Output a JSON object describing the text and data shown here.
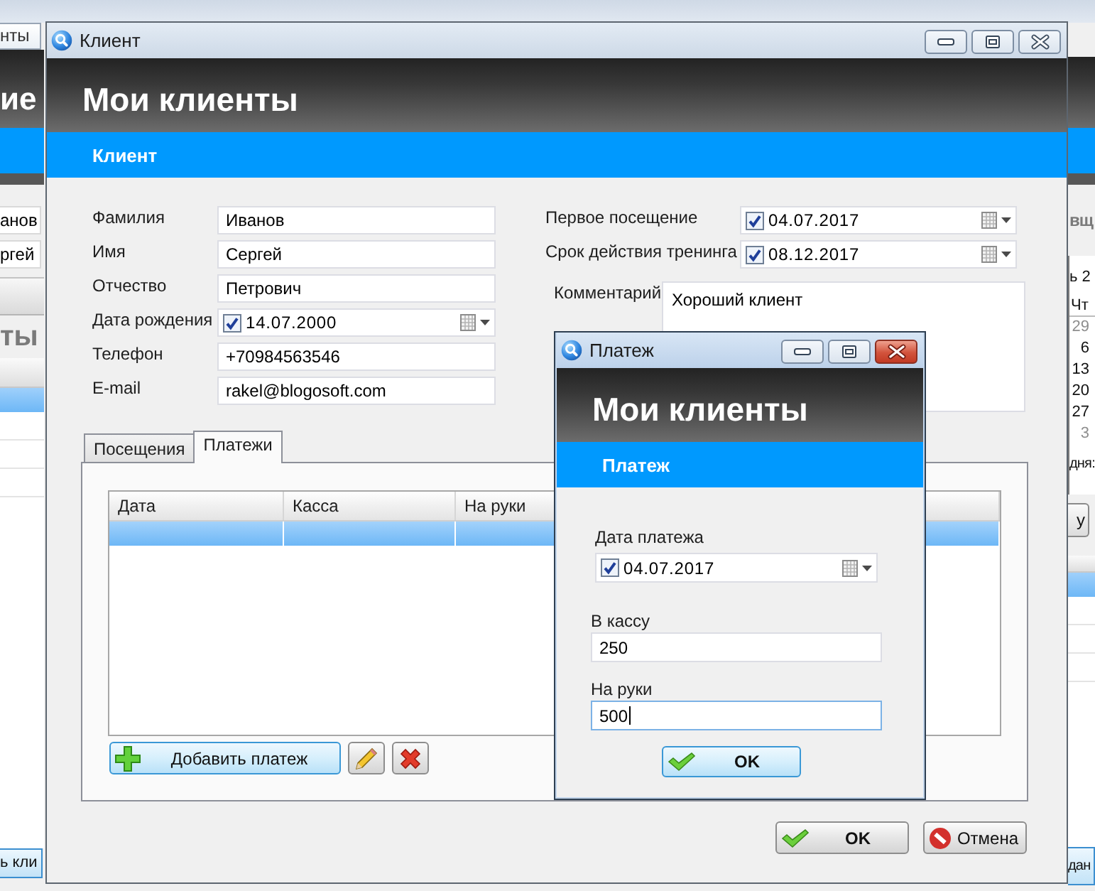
{
  "background_app": {
    "left": {
      "tab": "нты",
      "app_title": "ие",
      "fields": [
        "анов",
        "ргей"
      ],
      "section_heading": "ты",
      "table_rows": [
        {
          "selected": true
        },
        {
          "selected": false
        },
        {
          "selected": false
        },
        {
          "selected": false
        }
      ],
      "button": "ь кли"
    },
    "right": {
      "section_heading": "вщ",
      "calendar": {
        "month": "ь 2",
        "weekday": "Чт",
        "days": [
          {
            "label": "29",
            "other_month": true
          },
          {
            "label": "6",
            "other_month": false
          },
          {
            "label": "13",
            "other_month": false
          },
          {
            "label": "20",
            "other_month": false
          },
          {
            "label": "27",
            "other_month": false
          },
          {
            "label": "3",
            "other_month": true
          }
        ]
      },
      "caption": "дня:",
      "button": "у",
      "table_rows": [
        {
          "selected": true
        },
        {
          "selected": false
        },
        {
          "selected": false
        },
        {
          "selected": false
        }
      ],
      "bottom_button": "дан"
    }
  },
  "client_window": {
    "title": "Клиент",
    "active": false,
    "app_title": "Мои клиенты",
    "section_title": "Клиент",
    "fields_left": [
      {
        "kind": "text",
        "label": "Фамилия",
        "value": "Иванов"
      },
      {
        "kind": "text",
        "label": "Имя",
        "value": "Сергей"
      },
      {
        "kind": "text",
        "label": "Отчество",
        "value": "Петрович"
      },
      {
        "kind": "date",
        "label": "Дата рождения",
        "value": "14.07.2000",
        "checked": true
      },
      {
        "kind": "text",
        "label": "Телефон",
        "value": "+70984563546"
      },
      {
        "kind": "text",
        "label": "E-mail",
        "value": "rakel@blogosoft.com"
      }
    ],
    "fields_right": [
      {
        "kind": "date",
        "label": "Первое посещение",
        "value": "04.07.2017",
        "checked": true
      },
      {
        "kind": "date",
        "label": "Срок действия тренинга",
        "value": "08.12.2017",
        "checked": true
      },
      {
        "kind": "memo",
        "label": "Комментарий",
        "value": "Хороший клиент"
      }
    ],
    "tabs": [
      {
        "label": "Посещения",
        "selected": false
      },
      {
        "label": "Платежи",
        "selected": true
      }
    ],
    "table": {
      "columns": [
        "Дата",
        "Касса",
        "На руки"
      ],
      "rows": [
        {
          "selected": true
        }
      ]
    },
    "table_buttons": [
      {
        "kind": "add",
        "label": "Добавить платеж",
        "highlighted": true
      },
      {
        "kind": "edit",
        "highlighted": false
      },
      {
        "kind": "delete",
        "highlighted": false
      }
    ],
    "buttons": [
      {
        "kind": "ok",
        "label": "OK",
        "highlighted": false
      },
      {
        "kind": "cancel",
        "label": "Отмена",
        "highlighted": false
      }
    ]
  },
  "payment_dialog": {
    "title": "Платеж",
    "active": true,
    "app_title": "Мои клиенты",
    "section_title": "Платеж",
    "fields": [
      {
        "kind": "date",
        "label": "Дата платежа",
        "value": "04.07.2017",
        "checked": true,
        "focused": false
      },
      {
        "kind": "text",
        "label": "В кассу",
        "value": "250",
        "focused": false
      },
      {
        "kind": "text",
        "label": "На руки",
        "value": "500",
        "focused": true
      }
    ],
    "buttons": [
      {
        "kind": "ok",
        "label": "OK",
        "highlighted": true
      }
    ]
  }
}
